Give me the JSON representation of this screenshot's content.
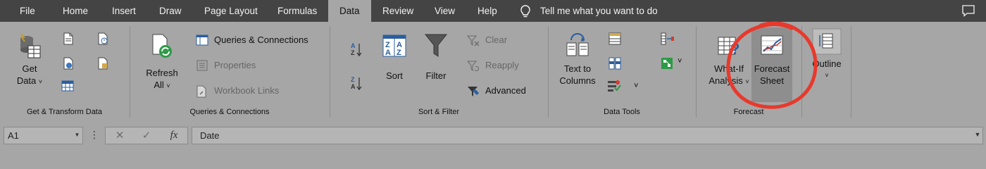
{
  "tabs": [
    {
      "label": "File"
    },
    {
      "label": "Home"
    },
    {
      "label": "Insert"
    },
    {
      "label": "Draw"
    },
    {
      "label": "Page Layout"
    },
    {
      "label": "Formulas"
    },
    {
      "label": "Data"
    },
    {
      "label": "Review"
    },
    {
      "label": "View"
    },
    {
      "label": "Help"
    }
  ],
  "tell_me": "Tell me what you want to do",
  "groups": {
    "get_transform": {
      "label": "Get & Transform Data",
      "get_data": {
        "line1": "Get",
        "line2": "Data"
      }
    },
    "queries": {
      "label": "Queries & Connections",
      "refresh_all": {
        "line1": "Refresh",
        "line2": "All"
      },
      "queries_connections": "Queries & Connections",
      "properties": "Properties",
      "workbook_links": "Workbook Links"
    },
    "sort_filter": {
      "label": "Sort & Filter",
      "sort": "Sort",
      "filter": "Filter",
      "clear": "Clear",
      "reapply": "Reapply",
      "advanced": "Advanced"
    },
    "data_tools": {
      "label": "Data Tools",
      "text_to_columns": {
        "line1": "Text to",
        "line2": "Columns"
      }
    },
    "forecast": {
      "label": "Forecast",
      "what_if": {
        "line1": "What-If",
        "line2": "Analysis"
      },
      "forecast_sheet": {
        "line1": "Forecast",
        "line2": "Sheet"
      }
    },
    "outline": {
      "outline": "Outline"
    }
  },
  "formula_bar": {
    "name_box": "A1",
    "formula": "Date",
    "fx": "fx"
  },
  "colors": {
    "tab_bar": "#444444",
    "ribbon": "#a6a6a6",
    "annotation_circle": "#e8392c"
  },
  "icons": [
    "lightbulb-icon",
    "comment-icon",
    "sort-az-icon",
    "funnel-icon",
    "chart-icon"
  ]
}
